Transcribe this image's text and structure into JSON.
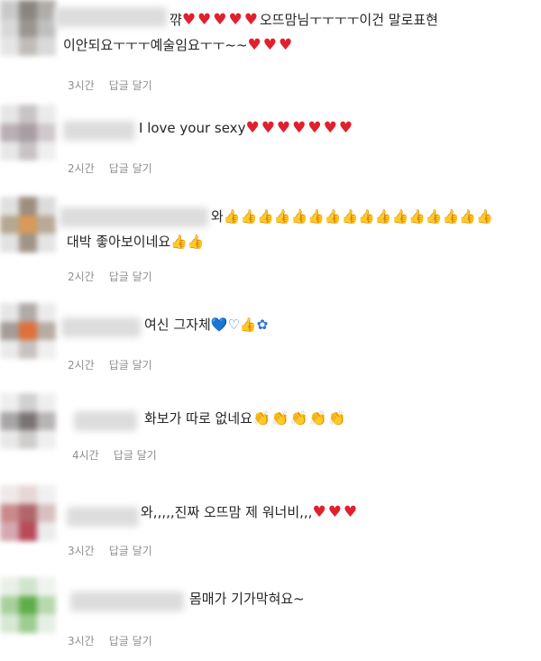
{
  "comments": [
    {
      "text_line1": "꺆",
      "emoji_line1": "♥♥♥♥♥",
      "text_line1b": "오뜨맘님ㅜㅜㅜㅜ이건 말로표현",
      "text_line2": "이안되요ㅜㅜㅜ예술임요ㅜㅜ~~",
      "emoji_line2": "♥♥♥",
      "time": "3시간",
      "reply": "답글 달기",
      "avatar_colors": [
        "#c9c9c9",
        "#8a8580",
        "#b0aca8",
        "#d8d8d8",
        "#9a9590",
        "#bfbfbf",
        "#e5e5e5",
        "#c0bdb9",
        "#d9d9d9"
      ]
    },
    {
      "text_line1": "I love your sexy",
      "emoji_line1": "♥♥♥♥♥♥♥",
      "time": "2시간",
      "reply": "답글 달기",
      "avatar_colors": [
        "#e6e6e6",
        "#c8c4c6",
        "#ebebeb",
        "#b9b0b5",
        "#a89da3",
        "#cfc8cc",
        "#e7e7e7",
        "#c8c2c5",
        "#efefef"
      ]
    },
    {
      "text_line1": "와",
      "emoji_line1": "👍👍👍👍👍👍👍👍👍👍👍👍👍👍👍👍",
      "text_line2": "대박 좋아보이네요",
      "emoji_line2": "👍👍",
      "time": "2시간",
      "reply": "답글 달기",
      "avatar_colors": [
        "#e0e0e0",
        "#9c8f80",
        "#dcdcdc",
        "#b5a890",
        "#d89a5a",
        "#b8aa98",
        "#e2e2e2",
        "#a09488",
        "#e4e4e4"
      ]
    },
    {
      "text_line1": "여신 그자체",
      "emoji_line1": "💙♡👍✿",
      "time": "2시간",
      "reply": "답글 달기",
      "avatar_colors": [
        "#e6e6e6",
        "#b0aaa8",
        "#ebebeb",
        "#a49c98",
        "#e0703a",
        "#b8aca4",
        "#eaeaea",
        "#c8c2bf",
        "#efefef"
      ]
    },
    {
      "text_line1": "화보가 따로 없네요",
      "emoji_line1": "👏👏👏👏👏",
      "time": "4시간",
      "reply": "답글 달기",
      "avatar_colors": [
        "#eeeeee",
        "#d0d0d0",
        "#eeeeee",
        "#a8a6a6",
        "#7c7474",
        "#b8b5b5",
        "#e8e8e8",
        "#cfcccc",
        "#efefef"
      ]
    },
    {
      "text_line1": "와,,,,,진짜 오뜨맘 제 워너비,,,",
      "emoji_line1": "♥♥♥",
      "time": "3시간",
      "reply": "답글 달기",
      "avatar_colors": [
        "#f0e8e8",
        "#e6d6d6",
        "#f0f0f0",
        "#c88a8a",
        "#b0666a",
        "#d8c0c0",
        "#d4a8b0",
        "#b84a5a",
        "#ececec"
      ]
    },
    {
      "text_line1": "몸매가 기가막혀요~",
      "time": "3시간",
      "reply": "답글 달기",
      "avatar_colors": [
        "#e8f0e8",
        "#d0e4cc",
        "#eef3ee",
        "#a8d09c",
        "#5fae4a",
        "#b8d8ae",
        "#d6e8d2",
        "#9fcc92",
        "#e6efe6"
      ]
    }
  ]
}
